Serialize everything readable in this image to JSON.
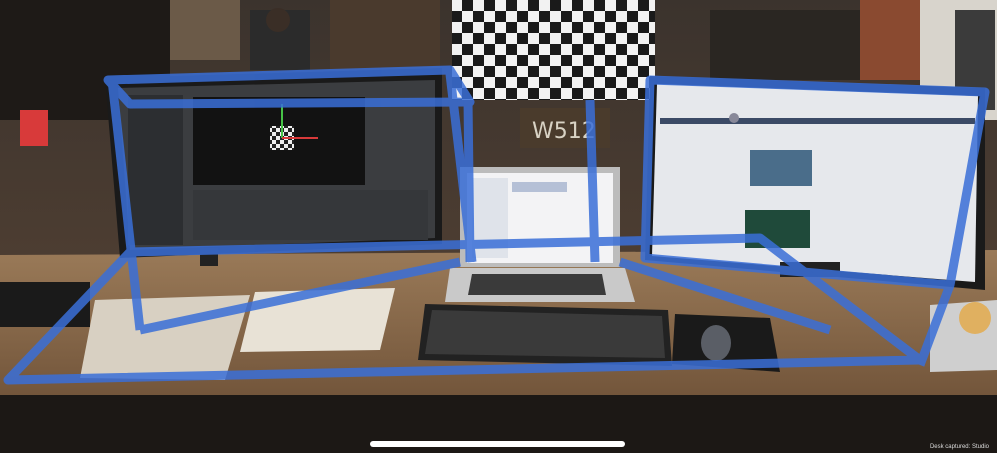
{
  "scene": {
    "description_label": "AR desk capture",
    "sign_text": "W512",
    "watermark": "Desk captured: Studio",
    "colors": {
      "overlay_blue": "#3a6fd8",
      "desk": "#8a6a4a",
      "checkerboard_dark": "#1a1a1a",
      "checkerboard_light": "#f2f2f2",
      "home_indicator": "#ffffff"
    }
  },
  "icons": [
    "checkerboard-marker-icon",
    "mouse-icon",
    "keyboard-icon"
  ]
}
